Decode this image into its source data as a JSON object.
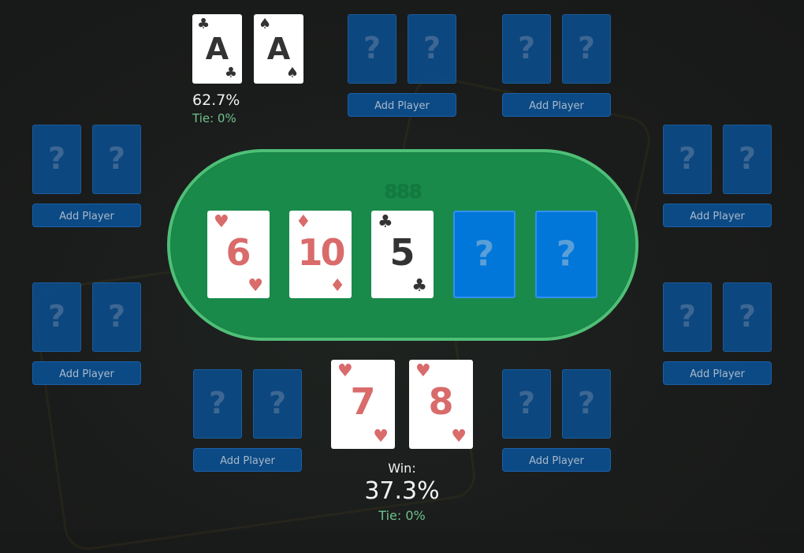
{
  "colors": {
    "background": "#1a1c1b",
    "felt": "#1a8a4b",
    "felt_rim": "#4fbf77",
    "empty_card": "#0c4a85",
    "board_empty_card": "#0077d9",
    "red_suit": "#d96b6b",
    "black_suit": "#333333",
    "tie_text": "#6fc28d"
  },
  "table": {
    "logo": "888",
    "board": [
      {
        "rank": "6",
        "suit": "♥",
        "suit_name": "hearts",
        "color": "red"
      },
      {
        "rank": "10",
        "suit": "♦",
        "suit_name": "diamonds",
        "color": "red"
      },
      {
        "rank": "5",
        "suit": "♣",
        "suit_name": "clubs",
        "color": "black"
      },
      {
        "rank": "?",
        "empty": true
      },
      {
        "rank": "?",
        "empty": true
      }
    ]
  },
  "empty_card_glyph": "?",
  "add_player_label": "Add Player",
  "players": {
    "top_left": {
      "cards": [
        {
          "rank": "A",
          "suit": "♣",
          "suit_name": "clubs",
          "color": "black"
        },
        {
          "rank": "A",
          "suit": "♠",
          "suit_name": "spades",
          "color": "black"
        }
      ],
      "win": "62.7%",
      "tie": "Tie: 0%"
    },
    "bottom_center": {
      "cards": [
        {
          "rank": "7",
          "suit": "♥",
          "suit_name": "hearts",
          "color": "red"
        },
        {
          "rank": "8",
          "suit": "♥",
          "suit_name": "hearts",
          "color": "red"
        }
      ],
      "win_label": "Win:",
      "win": "37.3%",
      "tie": "Tie: 0%"
    }
  },
  "empty_seats": [
    {
      "id": "top-center",
      "button": "Add Player"
    },
    {
      "id": "top-right",
      "button": "Add Player"
    },
    {
      "id": "left-upper",
      "button": "Add Player"
    },
    {
      "id": "right-upper",
      "button": "Add Player"
    },
    {
      "id": "left-lower",
      "button": "Add Player"
    },
    {
      "id": "right-lower",
      "button": "Add Player"
    },
    {
      "id": "bottom-left",
      "button": "Add Player"
    },
    {
      "id": "bottom-right",
      "button": "Add Player"
    }
  ]
}
